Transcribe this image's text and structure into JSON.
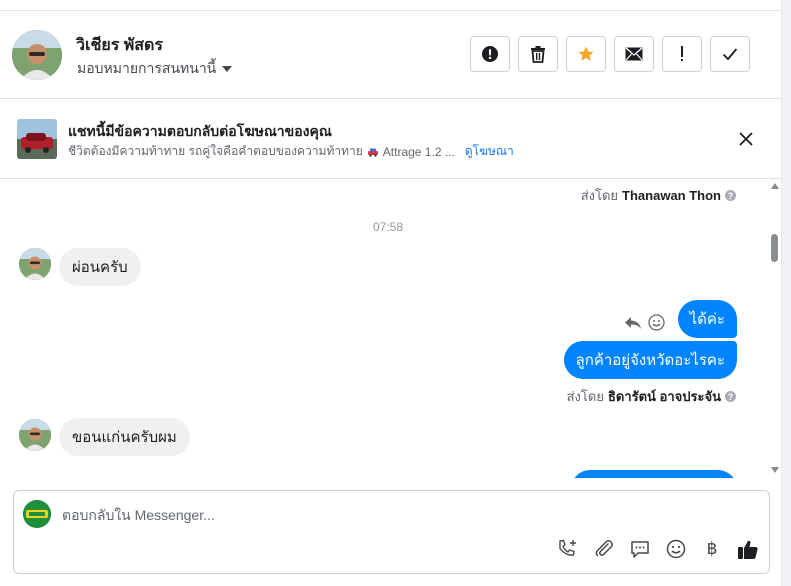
{
  "header": {
    "contact_name": "วิเชียร พัสดร",
    "assign_label": "มอบหมายการสนทนานี้",
    "actions": [
      {
        "name": "report-spam-button",
        "icon": "alert-circle-icon"
      },
      {
        "name": "delete-button",
        "icon": "trash-icon"
      },
      {
        "name": "star-button",
        "icon": "star-icon",
        "active_color": "#f5a623"
      },
      {
        "name": "mark-unread-button",
        "icon": "envelope-icon"
      },
      {
        "name": "mark-follow-up-button",
        "icon": "exclamation-icon"
      },
      {
        "name": "mark-done-button",
        "icon": "checkmark-icon"
      }
    ]
  },
  "ad_banner": {
    "title": "แชทนี้มีข้อความตอบกลับต่อโฆษณาของคุณ",
    "subtitle": "ชีวิตต้องมีความท้าทาย รถคู่ใจคือคำตอบของความท้าทาย",
    "ad_name": "Attrage 1.2 ...",
    "link_label": "ดูโฆษณา"
  },
  "conversation": {
    "top_sent_by_prefix": "ส่งโดย",
    "top_sent_by_name": "Thanawan Thon",
    "time": "07:58",
    "messages": [
      {
        "direction": "in",
        "text": "ผ่อนครับ"
      },
      {
        "direction": "out",
        "text": "ได้ค่ะ"
      },
      {
        "direction": "out",
        "text": "ลูกค้าอยู่จังหวัดอะไรคะ"
      },
      {
        "direction": "in",
        "text": "ขอนแก่นครับผม"
      }
    ],
    "sent_by_prefix": "ส่งโดย",
    "sent_by_name": "ธิดารัตน์ อาจประจัน",
    "info_glyph": "?"
  },
  "composer": {
    "placeholder": "ตอบกลับใน Messenger...",
    "currency_glyph": "฿",
    "tools": [
      "phone-plus-icon",
      "paperclip-icon",
      "saved-reply-icon",
      "emoji-icon",
      "baht-payment-icon",
      "thumbs-up-icon"
    ]
  },
  "colors": {
    "accent": "#0084ff",
    "link": "#1877f2",
    "star": "#f5a623",
    "incoming_bubble": "#f0f0f0"
  }
}
